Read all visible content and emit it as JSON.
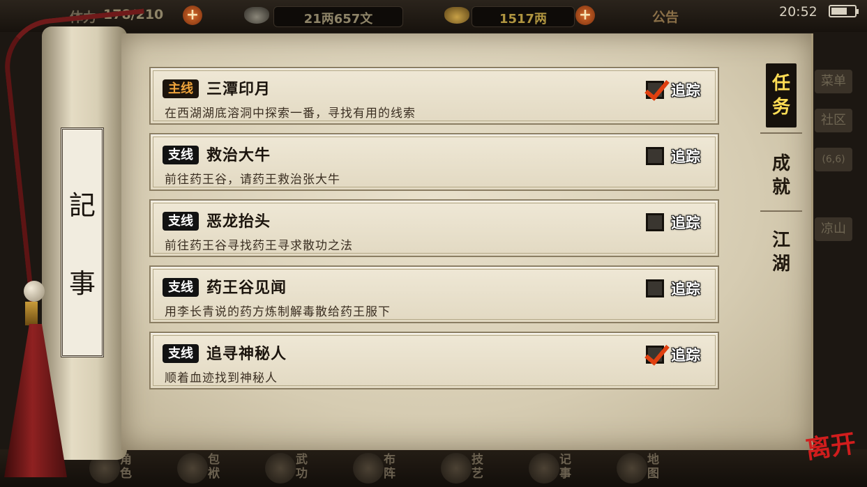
{
  "hud": {
    "stamina_label": "体力",
    "stamina_value": "178/210",
    "silver": "21两657文",
    "gold": "1517两",
    "notice": "公告",
    "time": "20:52"
  },
  "bottom_menu": [
    "角色",
    "包袱",
    "武功",
    "布阵",
    "技艺",
    "记事",
    "地图"
  ],
  "right_background_menu": [
    "菜单",
    "社区",
    "(6,6)",
    "凉山"
  ],
  "scroll_title": [
    "記",
    "事"
  ],
  "quests": [
    {
      "type": "主线",
      "title": "三潭印月",
      "desc": "在西湖湖底溶洞中探索一番，寻找有用的线索",
      "tracked": true,
      "track_label": "追踪"
    },
    {
      "type": "支线",
      "title": "救治大牛",
      "desc": "前往药王谷，请药王救治张大牛",
      "tracked": false,
      "track_label": "追踪"
    },
    {
      "type": "支线",
      "title": "恶龙抬头",
      "desc": "前往药王谷寻找药王寻求散功之法",
      "tracked": false,
      "track_label": "追踪"
    },
    {
      "type": "支线",
      "title": "药王谷见闻",
      "desc": "用李长青说的药方炼制解毒散给药王服下",
      "tracked": false,
      "track_label": "追踪"
    },
    {
      "type": "支线",
      "title": "追寻神秘人",
      "desc": "顺着血迹找到神秘人",
      "tracked": true,
      "track_label": "追踪"
    }
  ],
  "tabs": [
    {
      "label": "任务",
      "active": true
    },
    {
      "label": "成就",
      "active": false
    },
    {
      "label": "江湖",
      "active": false
    }
  ],
  "close_label": "离开",
  "colors": {
    "main_badge": "#f0a43b",
    "active_tab_text": "#ffdd55",
    "check_mark": "#e04010",
    "close": "#d11d1d"
  }
}
